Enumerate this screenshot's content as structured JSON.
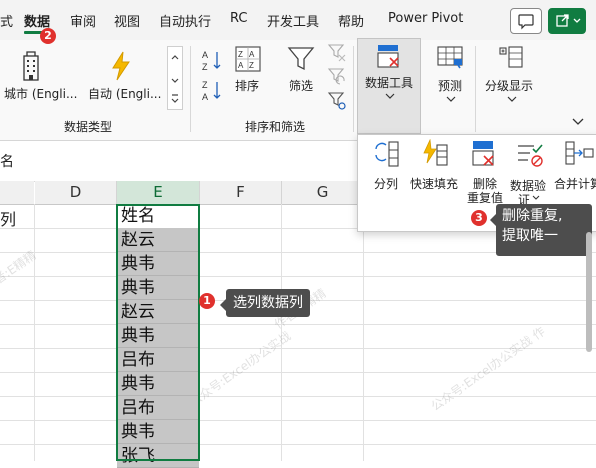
{
  "tabs": [
    "式",
    "数据",
    "审阅",
    "视图",
    "自动执行",
    "RC",
    "开发工具",
    "帮助",
    "Power Pivot"
  ],
  "ribbon": {
    "data_types": {
      "city": "城市 (Engli...",
      "auto": "自动 (Engli...",
      "group_label": "数据类型"
    },
    "sort_filter": {
      "sort": "排序",
      "filter": "筛选",
      "group_label": "排序和筛选"
    },
    "data_tools": "数据工具",
    "forecast": "预测",
    "outline": "分级显示"
  },
  "panel": {
    "split": "分列",
    "flash_fill": "快速填充",
    "remove_dup_1": "删除",
    "remove_dup_2": "重复值",
    "validate_1": "数据验",
    "validate_2": "证",
    "consolidate": "合并计算"
  },
  "formula_bar": {
    "left_char": "名"
  },
  "columns": [
    "D",
    "E",
    "F",
    "G"
  ],
  "left_cell_text": "列",
  "column_e": [
    "姓名",
    "赵云",
    "典韦",
    "典韦",
    "赵云",
    "典韦",
    "吕布",
    "典韦",
    "吕布",
    "典韦",
    "张飞"
  ],
  "callouts": [
    {
      "num": "1",
      "text": "选列数据列"
    },
    {
      "num": "2"
    },
    {
      "num": "3",
      "line1": "删除重复,",
      "line2": "提取唯一"
    }
  ],
  "watermarks": [
    "公众号:Excel办公实战",
    "作者:E精精",
    "公众号:Excel办公实战 作者:E精精",
    "公众号:Excel办公实战 作"
  ],
  "colors": {
    "excel_green": "#107c41",
    "badge_red": "#e0312d",
    "tooltip_bg": "#4d4d4d"
  }
}
